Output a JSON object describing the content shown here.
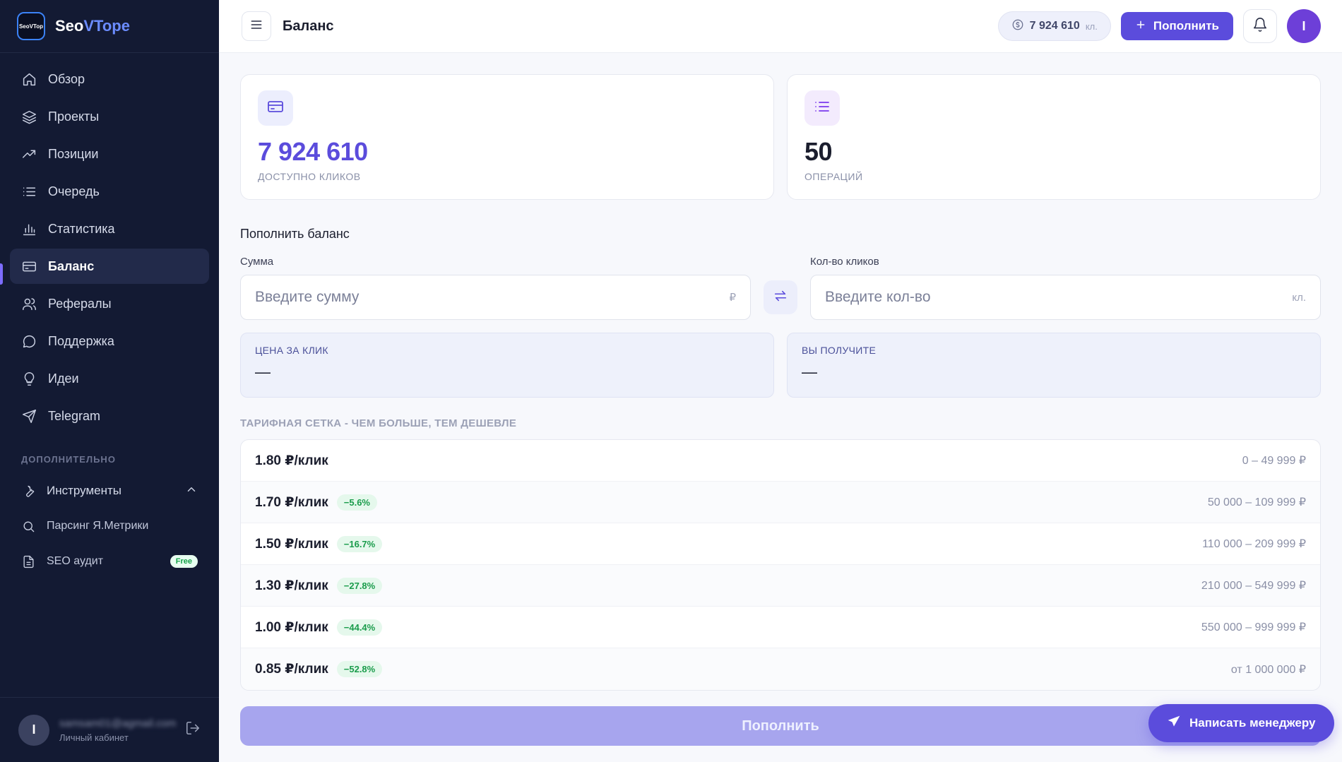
{
  "brand": {
    "logo_text": "SeoVTop",
    "name_main": "Seo",
    "name_accent": "VTope"
  },
  "sidebar": {
    "items": [
      {
        "label": "Обзор",
        "icon": "home-icon"
      },
      {
        "label": "Проекты",
        "icon": "layers-icon"
      },
      {
        "label": "Позиции",
        "icon": "trending-up-icon"
      },
      {
        "label": "Очередь",
        "icon": "list-icon"
      },
      {
        "label": "Статистика",
        "icon": "bar-chart-icon"
      },
      {
        "label": "Баланс",
        "icon": "credit-card-icon",
        "active": true
      },
      {
        "label": "Рефералы",
        "icon": "users-icon"
      },
      {
        "label": "Поддержка",
        "icon": "message-icon"
      },
      {
        "label": "Идеи",
        "icon": "lightbulb-icon"
      },
      {
        "label": "Telegram",
        "icon": "send-icon"
      }
    ],
    "section_title": "ДОПОЛНИТЕЛЬНО",
    "tools": {
      "label": "Инструменты",
      "icon": "wrench-icon"
    },
    "tool_items": [
      {
        "label": "Парсинг Я.Метрики",
        "icon": "search-icon"
      },
      {
        "label": "SEO аудит",
        "icon": "file-icon",
        "badge": "Free"
      }
    ],
    "user": {
      "avatar_letter": "I",
      "name": "samsam01@agmail.com",
      "subtitle": "Личный кабинет"
    }
  },
  "header": {
    "title": "Баланс",
    "balance_value": "7 924 610",
    "balance_unit": "кл.",
    "topup_label": "Пополнить",
    "avatar_letter": "I"
  },
  "stats": {
    "clicks_value": "7 924 610",
    "clicks_label": "ДОСТУПНО КЛИКОВ",
    "ops_value": "50",
    "ops_label": "ОПЕРАЦИЙ"
  },
  "form": {
    "title": "Пополнить баланс",
    "sum_label": "Сумма",
    "sum_placeholder": "Введите сумму",
    "sum_suffix": "₽",
    "clicks_label": "Кол-во кликов",
    "clicks_placeholder": "Введите кол-во",
    "clicks_suffix": "кл.",
    "price_label": "ЦЕНА ЗА КЛИК",
    "price_value": "—",
    "receive_label": "ВЫ ПОЛУЧИТЕ",
    "receive_value": "—",
    "submit_label": "Пополнить"
  },
  "tariff": {
    "title": "ТАРИФНАЯ СЕТКА - ЧЕМ БОЛЬШЕ, ТЕМ ДЕШЕВЛЕ",
    "rows": [
      {
        "price": "1.80 ₽/клик",
        "discount": "",
        "range": "0 – 49 999 ₽"
      },
      {
        "price": "1.70 ₽/клик",
        "discount": "−5.6%",
        "range": "50 000 – 109 999 ₽"
      },
      {
        "price": "1.50 ₽/клик",
        "discount": "−16.7%",
        "range": "110 000 – 209 999 ₽"
      },
      {
        "price": "1.30 ₽/клик",
        "discount": "−27.8%",
        "range": "210 000 – 549 999 ₽"
      },
      {
        "price": "1.00 ₽/клик",
        "discount": "−44.4%",
        "range": "550 000 – 999 999 ₽"
      },
      {
        "price": "0.85 ₽/клик",
        "discount": "−52.8%",
        "range": "от 1 000 000 ₽"
      }
    ]
  },
  "float_button": {
    "label": "Написать менеджеру",
    "icon": "send-icon"
  },
  "colors": {
    "accent": "#5b4cdc",
    "sidebar_bg": "#131a33",
    "discount_green": "#1a9c4b"
  }
}
